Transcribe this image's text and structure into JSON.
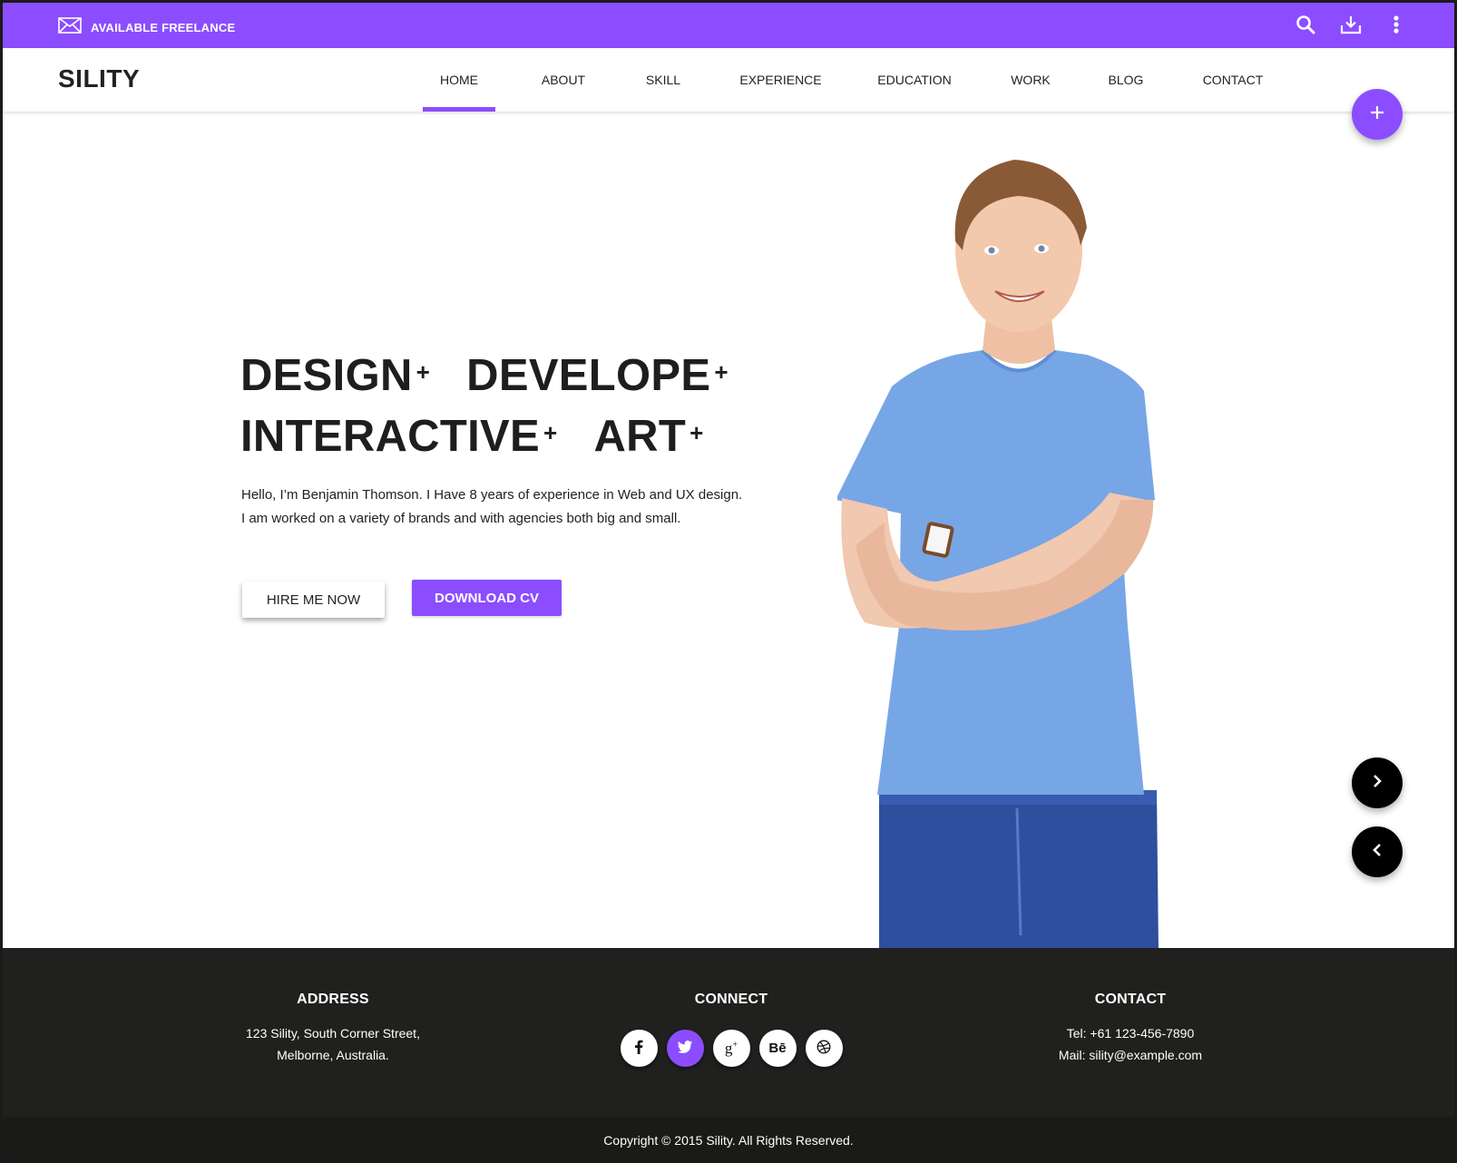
{
  "topbar": {
    "freelance_label": "AVAILABLE FREELANCE",
    "icons": [
      "mail-icon",
      "search-icon",
      "download-icon",
      "more-vert-icon"
    ]
  },
  "header": {
    "logo": "SILITY",
    "nav": [
      {
        "label": "HOME",
        "active": true
      },
      {
        "label": "ABOUT",
        "active": false
      },
      {
        "label": "SKILL",
        "active": false
      },
      {
        "label": "EXPERIENCE",
        "active": false
      },
      {
        "label": "EDUCATION",
        "active": false
      },
      {
        "label": "WORK",
        "active": false
      },
      {
        "label": "BLOG",
        "active": false
      },
      {
        "label": "CONTACT",
        "active": false
      }
    ],
    "fab_icon": "plus-icon"
  },
  "hero": {
    "title_words": [
      "DESIGN",
      "DEVELOPE",
      "INTERACTIVE",
      "ART"
    ],
    "title_mark": "+",
    "text_line1": "Hello, I’m Benjamin Thomson. I Have 8 years of experience in Web and UX design.",
    "text_line2": "I am worked on a variety of brands and with agencies both big and small.",
    "hire_label": "HIRE ME NOW",
    "download_label": "DOWNLOAD CV",
    "portrait_alt": "Smiling man in blue t-shirt with arms crossed",
    "next_icon": "chevron-right-icon",
    "prev_icon": "chevron-left-icon"
  },
  "footer": {
    "address": {
      "title": "ADDRESS",
      "line1": "123 Sility, South Corner Street,",
      "line2": "Melborne, Australia."
    },
    "connect": {
      "title": "CONNECT",
      "socials": [
        {
          "name": "facebook",
          "glyph": "f",
          "active": false
        },
        {
          "name": "twitter",
          "glyph": "t",
          "active": true
        },
        {
          "name": "google-plus",
          "glyph": "g+",
          "active": false
        },
        {
          "name": "behance",
          "glyph": "Bē",
          "active": false
        },
        {
          "name": "dribbble",
          "glyph": "⊛",
          "active": false
        }
      ]
    },
    "contact": {
      "title": "CONTACT",
      "tel": "Tel: +61 123-456-7890",
      "mail": "Mail: sility@example.com"
    },
    "copyright": "Copyright © 2015 Sility. All Rights Reserved."
  },
  "colors": {
    "accent": "#8b4dff",
    "footer_bg": "#20201e",
    "copy_bg": "#1a1a17",
    "dark_button": "#000000"
  }
}
